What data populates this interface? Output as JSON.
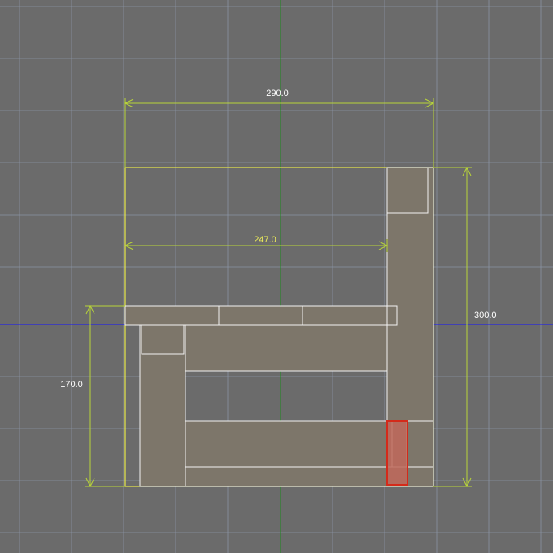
{
  "viewport": {
    "background": "#6b6b6b",
    "grid_color": "#8a93a3",
    "x_axis_color": "#1414ff",
    "y_axis_color": "#1e8a1e",
    "outline_color": "#e8e84a",
    "dimension_color": "#b8d43a",
    "part_fill": "#7d766a",
    "part_stroke": "#f2f2f2",
    "selected_fill": "#c0685a",
    "selected_stroke": "#d42a1a"
  },
  "dimensions": {
    "overall_width": "290.0",
    "inner_width": "247.0",
    "overall_depth": "300.0",
    "left_depth": "170.0"
  }
}
